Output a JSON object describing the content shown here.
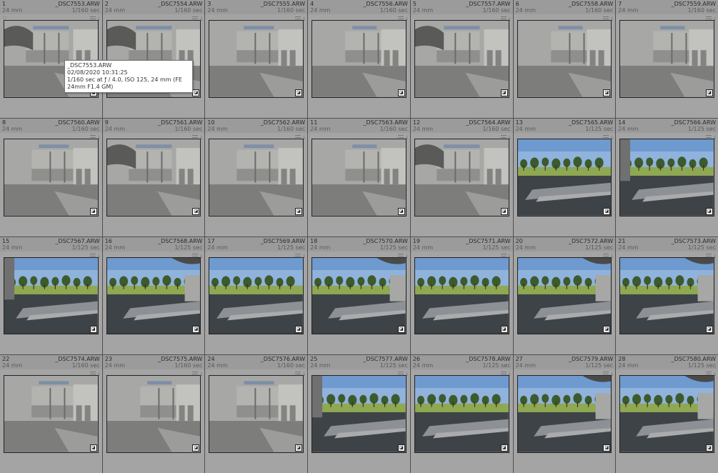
{
  "tooltip": {
    "file": "_DSC7553.ARW",
    "date": "02/08/2020 10:31:25",
    "exif": "1/160 sec at ƒ / 4.0, ISO 125, 24 mm (FE 24mm F1.4 GM)"
  },
  "thumbs": [
    {
      "index": "1",
      "file": "_DSC7553.ARW",
      "focal": "24 mm",
      "shutter": "1/160 sec",
      "scene": "building",
      "variant": 0
    },
    {
      "index": "2",
      "file": "_DSC7554.ARW",
      "focal": "24 mm",
      "shutter": "1/160 sec",
      "scene": "building",
      "variant": 0
    },
    {
      "index": "3",
      "file": "_DSC7555.ARW",
      "focal": "24 mm",
      "shutter": "1/160 sec",
      "scene": "building",
      "variant": 1
    },
    {
      "index": "4",
      "file": "_DSC7556.ARW",
      "focal": "24 mm",
      "shutter": "1/160 sec",
      "scene": "building",
      "variant": 2
    },
    {
      "index": "5",
      "file": "_DSC7557.ARW",
      "focal": "24 mm",
      "shutter": "1/160 sec",
      "scene": "building",
      "variant": 0
    },
    {
      "index": "6",
      "file": "_DSC7558.ARW",
      "focal": "24 mm",
      "shutter": "1/160 sec",
      "scene": "building",
      "variant": 2
    },
    {
      "index": "7",
      "file": "_DSC7559.ARW",
      "focal": "24 mm",
      "shutter": "1/160 sec",
      "scene": "building",
      "variant": 2
    },
    {
      "index": "8",
      "file": "_DSC7560.ARW",
      "focal": "24 mm",
      "shutter": "1/160 sec",
      "scene": "building",
      "variant": 1
    },
    {
      "index": "9",
      "file": "_DSC7561.ARW",
      "focal": "24 mm",
      "shutter": "1/160 sec",
      "scene": "building",
      "variant": 0
    },
    {
      "index": "10",
      "file": "_DSC7562.ARW",
      "focal": "24 mm",
      "shutter": "1/160 sec",
      "scene": "building",
      "variant": 1
    },
    {
      "index": "11",
      "file": "_DSC7563.ARW",
      "focal": "24 mm",
      "shutter": "1/160 sec",
      "scene": "building",
      "variant": 2
    },
    {
      "index": "12",
      "file": "_DSC7564.ARW",
      "focal": "24 mm",
      "shutter": "1/160 sec",
      "scene": "building",
      "variant": 0
    },
    {
      "index": "13",
      "file": "_DSC7565.ARW",
      "focal": "24 mm",
      "shutter": "1/125 sec",
      "scene": "park",
      "variant": 0
    },
    {
      "index": "14",
      "file": "_DSC7566.ARW",
      "focal": "24 mm",
      "shutter": "1/125 sec",
      "scene": "park",
      "variant": 1
    },
    {
      "index": "15",
      "file": "_DSC7567.ARW",
      "focal": "24 mm",
      "shutter": "1/125 sec",
      "scene": "park",
      "variant": 1
    },
    {
      "index": "16",
      "file": "_DSC7568.ARW",
      "focal": "24 mm",
      "shutter": "1/125 sec",
      "scene": "park",
      "variant": 2
    },
    {
      "index": "17",
      "file": "_DSC7569.ARW",
      "focal": "24 mm",
      "shutter": "1/125 sec",
      "scene": "park",
      "variant": 0
    },
    {
      "index": "18",
      "file": "_DSC7570.ARW",
      "focal": "24 mm",
      "shutter": "1/125 sec",
      "scene": "park",
      "variant": 2
    },
    {
      "index": "19",
      "file": "_DSC7571.ARW",
      "focal": "24 mm",
      "shutter": "1/125 sec",
      "scene": "park",
      "variant": 0
    },
    {
      "index": "20",
      "file": "_DSC7572.ARW",
      "focal": "24 mm",
      "shutter": "1/125 sec",
      "scene": "park",
      "variant": 2
    },
    {
      "index": "21",
      "file": "_DSC7573.ARW",
      "focal": "24 mm",
      "shutter": "1/125 sec",
      "scene": "park",
      "variant": 2
    },
    {
      "index": "22",
      "file": "_DSC7574.ARW",
      "focal": "24 mm",
      "shutter": "1/160 sec",
      "scene": "building",
      "variant": 1
    },
    {
      "index": "23",
      "file": "_DSC7575.ARW",
      "focal": "24 mm",
      "shutter": "1/160 sec",
      "scene": "building",
      "variant": 2
    },
    {
      "index": "24",
      "file": "_DSC7576.ARW",
      "focal": "24 mm",
      "shutter": "1/160 sec",
      "scene": "building",
      "variant": 1
    },
    {
      "index": "25",
      "file": "_DSC7577.ARW",
      "focal": "24 mm",
      "shutter": "1/125 sec",
      "scene": "park",
      "variant": 1
    },
    {
      "index": "26",
      "file": "_DSC7578.ARW",
      "focal": "24 mm",
      "shutter": "1/125 sec",
      "scene": "park",
      "variant": 0
    },
    {
      "index": "27",
      "file": "_DSC7579.ARW",
      "focal": "24 mm",
      "shutter": "1/125 sec",
      "scene": "park",
      "variant": 2
    },
    {
      "index": "28",
      "file": "_DSC7580.ARW",
      "focal": "24 mm",
      "shutter": "1/125 sec",
      "scene": "park",
      "variant": 2
    }
  ],
  "icons": {
    "metadata": "metadata-lines-icon",
    "edited": "develop-adjusted-icon",
    "flag": "flag-icon"
  }
}
